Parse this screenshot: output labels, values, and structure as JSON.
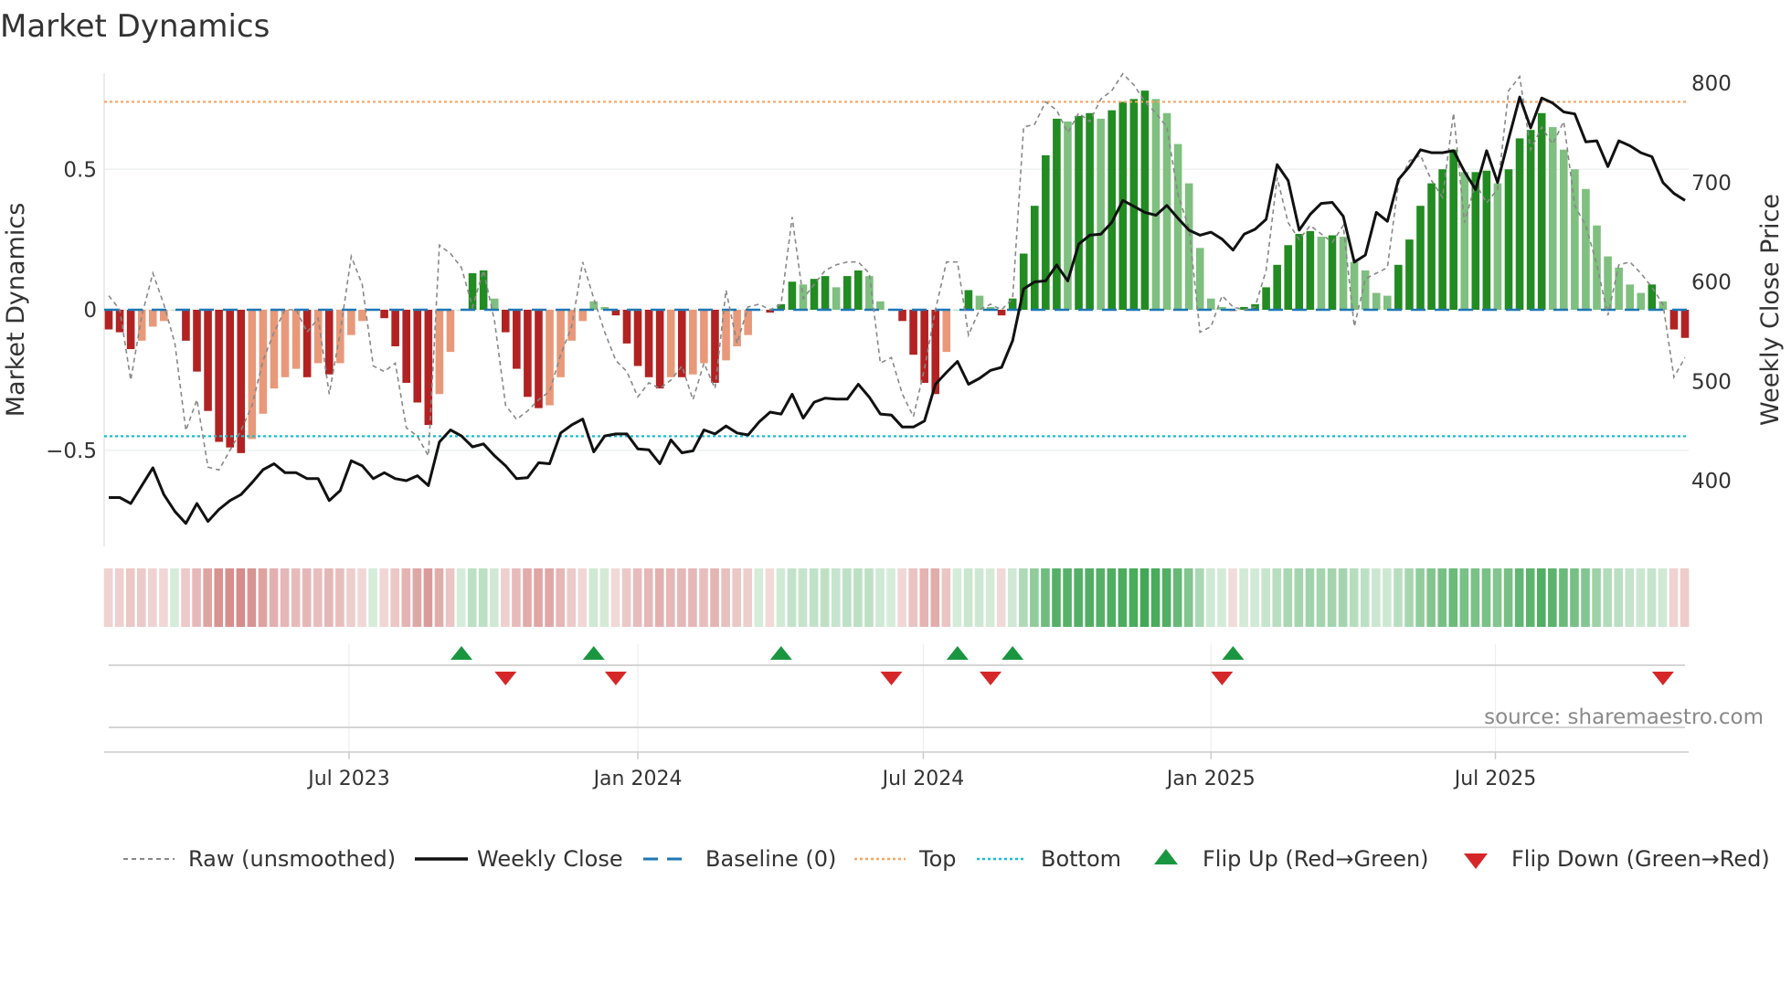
{
  "chart_data": {
    "type": "bar",
    "title": "Market Dynamics",
    "ylabel": "Market Dynamics",
    "y2label": "Weekly Close Price",
    "source": "source: sharemaestro.com",
    "ylim": [
      -0.82,
      0.85
    ],
    "y2lim": [
      330,
      830
    ],
    "yticks": [
      {
        "v": 0.5,
        "label": "0.5"
      },
      {
        "v": 0,
        "label": "0"
      },
      {
        "v": -0.5,
        "label": "−0.5"
      }
    ],
    "y2ticks": [
      {
        "v": 800,
        "label": "800"
      },
      {
        "v": 700,
        "label": "700"
      },
      {
        "v": 600,
        "label": "600"
      },
      {
        "v": 500,
        "label": "500"
      },
      {
        "v": 400,
        "label": "400"
      }
    ],
    "start_week": "2023-02-03",
    "xticks": [
      {
        "week": 21.8,
        "label": "Jul 2023"
      },
      {
        "week": 48,
        "label": "Jan 2024"
      },
      {
        "week": 73.9,
        "label": "Jul 2024"
      },
      {
        "week": 100,
        "label": "Jan 2025"
      },
      {
        "week": 125.8,
        "label": "Jul 2025"
      }
    ],
    "top_level": 0.74,
    "bottom_level": -0.45,
    "baseline": 0,
    "series": [
      {
        "name": "Market Dynamics (smoothed)",
        "values": [
          -0.07,
          -0.08,
          -0.14,
          -0.11,
          -0.06,
          -0.04,
          0,
          -0.11,
          -0.22,
          -0.36,
          -0.47,
          -0.49,
          -0.51,
          -0.46,
          -0.37,
          -0.28,
          -0.24,
          -0.21,
          -0.24,
          -0.19,
          -0.23,
          -0.19,
          -0.09,
          -0.04,
          0,
          -0.03,
          -0.13,
          -0.26,
          -0.33,
          -0.41,
          -0.3,
          -0.15,
          0,
          0.13,
          0.14,
          0.04,
          -0.08,
          -0.21,
          -0.31,
          -0.35,
          -0.34,
          -0.24,
          -0.11,
          -0.04,
          0.03,
          0.01,
          -0.02,
          -0.12,
          -0.2,
          -0.24,
          -0.28,
          -0.24,
          -0.24,
          -0.23,
          -0.19,
          -0.26,
          -0.18,
          -0.13,
          -0.09,
          0,
          -0.01,
          0.02,
          0.1,
          0.09,
          0.11,
          0.12,
          0.08,
          0.12,
          0.14,
          0.12,
          0.03,
          0,
          -0.04,
          -0.16,
          -0.26,
          -0.3,
          -0.15,
          0,
          0.07,
          0.05,
          0.01,
          -0.02,
          0.04,
          0.2,
          0.37,
          0.55,
          0.68,
          0.67,
          0.69,
          0.7,
          0.68,
          0.71,
          0.74,
          0.75,
          0.78,
          0.75,
          0.7,
          0.59,
          0.45,
          0.22,
          0.04,
          0.01,
          -0.005,
          0.01,
          0.02,
          0.08,
          0.16,
          0.23,
          0.27,
          0.28,
          0.26,
          0.265,
          0.26,
          0.17,
          0.14,
          0.06,
          0.05,
          0.16,
          0.25,
          0.37,
          0.45,
          0.5,
          0.57,
          0.49,
          0.49,
          0.495,
          0.45,
          0.5,
          0.61,
          0.64,
          0.7,
          0.65,
          0.57,
          0.5,
          0.43,
          0.3,
          0.19,
          0.15,
          0.09,
          0.06,
          0.09,
          0.03,
          -0.07,
          -0.1
        ]
      },
      {
        "name": "Raw (unsmoothed)",
        "values": [
          0.05,
          0,
          -0.25,
          -0.02,
          0.13,
          0.02,
          -0.12,
          -0.43,
          -0.32,
          -0.56,
          -0.57,
          -0.5,
          -0.43,
          -0.34,
          -0.18,
          -0.08,
          0,
          0,
          -0.08,
          -0.03,
          -0.3,
          -0.08,
          0.19,
          0.09,
          -0.2,
          -0.22,
          -0.19,
          -0.42,
          -0.45,
          -0.52,
          0.23,
          0.2,
          0.15,
          0.01,
          0.14,
          -0.04,
          -0.34,
          -0.39,
          -0.36,
          -0.32,
          -0.29,
          -0.16,
          -0.06,
          0.17,
          0.04,
          -0.08,
          -0.18,
          -0.22,
          -0.31,
          -0.26,
          -0.28,
          -0.25,
          -0.2,
          -0.32,
          -0.19,
          -0.28,
          0.07,
          -0.12,
          0.01,
          0.02,
          0,
          0.02,
          0.33,
          0.04,
          0.09,
          0.14,
          0.16,
          0.17,
          0.17,
          0.13,
          -0.19,
          -0.17,
          -0.3,
          -0.38,
          -0.21,
          0,
          0.17,
          0.17,
          -0.09,
          0,
          0.02,
          0,
          0.04,
          0.65,
          0.66,
          0.74,
          0.71,
          0.63,
          0.7,
          0.67,
          0.75,
          0.78,
          0.84,
          0.8,
          0.74,
          0.7,
          0.65,
          0.41,
          0.29,
          -0.08,
          -0.06,
          0.05,
          0.01,
          0,
          0.01,
          0.14,
          0.47,
          0.31,
          0.25,
          0.3,
          0.27,
          0.24,
          0.3,
          -0.06,
          0.11,
          0.13,
          0.15,
          0.45,
          0.53,
          0.55,
          0.46,
          0.4,
          0.7,
          0.31,
          0.45,
          0.38,
          0.43,
          0.78,
          0.83,
          0.57,
          0.65,
          0.59,
          0.67,
          0.37,
          0.3,
          0.16,
          -0.02,
          0.16,
          0.17,
          0.13,
          0.08,
          0.02,
          -0.24,
          -0.17
        ]
      },
      {
        "name": "Weekly Close",
        "values": [
          383,
          383,
          377,
          395,
          413,
          386,
          369,
          357,
          377,
          359,
          371,
          380,
          386,
          398,
          411,
          417,
          408,
          408,
          402,
          402,
          380,
          390,
          420,
          415,
          402,
          408,
          402,
          400,
          405,
          395,
          439,
          451,
          445,
          434,
          437,
          425,
          415,
          402,
          403,
          418,
          417,
          448,
          456,
          462,
          429,
          445,
          447,
          447,
          432,
          431,
          417,
          441,
          428,
          430,
          451,
          447,
          455,
          448,
          446,
          459,
          469,
          467,
          487,
          463,
          479,
          483,
          482,
          482,
          497,
          484,
          467,
          466,
          454,
          454,
          460,
          497,
          509,
          520,
          497,
          503,
          511,
          514,
          541,
          593,
          600,
          601,
          617,
          601,
          638,
          647,
          648,
          660,
          682,
          676,
          670,
          667,
          677,
          664,
          652,
          647,
          650,
          643,
          632,
          648,
          653,
          663,
          718,
          702,
          652,
          668,
          679,
          680,
          666,
          620,
          627,
          670,
          661,
          703,
          716,
          733,
          730,
          730,
          732,
          711,
          693,
          732,
          700,
          744,
          786,
          755,
          785,
          780,
          771,
          769,
          741,
          742,
          716,
          742,
          737,
          730,
          726,
          700,
          689,
          682
        ]
      }
    ],
    "flip_up_weeks": [
      32,
      44,
      61,
      77,
      82,
      102
    ],
    "flip_down_weeks": [
      36,
      46,
      71,
      80,
      101,
      141
    ],
    "legend_position": "bottom",
    "legend": {
      "raw": "Raw (unsmoothed)",
      "close": "Weekly Close",
      "baseline": "Baseline (0)",
      "top": "Top",
      "bottom": "Bottom",
      "flip_up": "Flip Up (Red→Green)",
      "flip_down": "Flip Down (Green→Red)"
    },
    "colors": {
      "pos_strong": "#228b22",
      "pos_weak": "#7fbf7f",
      "neg_strong": "#b22222",
      "neg_weak": "#e8997a",
      "close": "#111111",
      "raw": "#888888",
      "baseline": "#1f77b4",
      "top": "#f4a460",
      "bottom": "#17becf",
      "flip_up": "#1a9641",
      "flip_down": "#d62728"
    }
  }
}
